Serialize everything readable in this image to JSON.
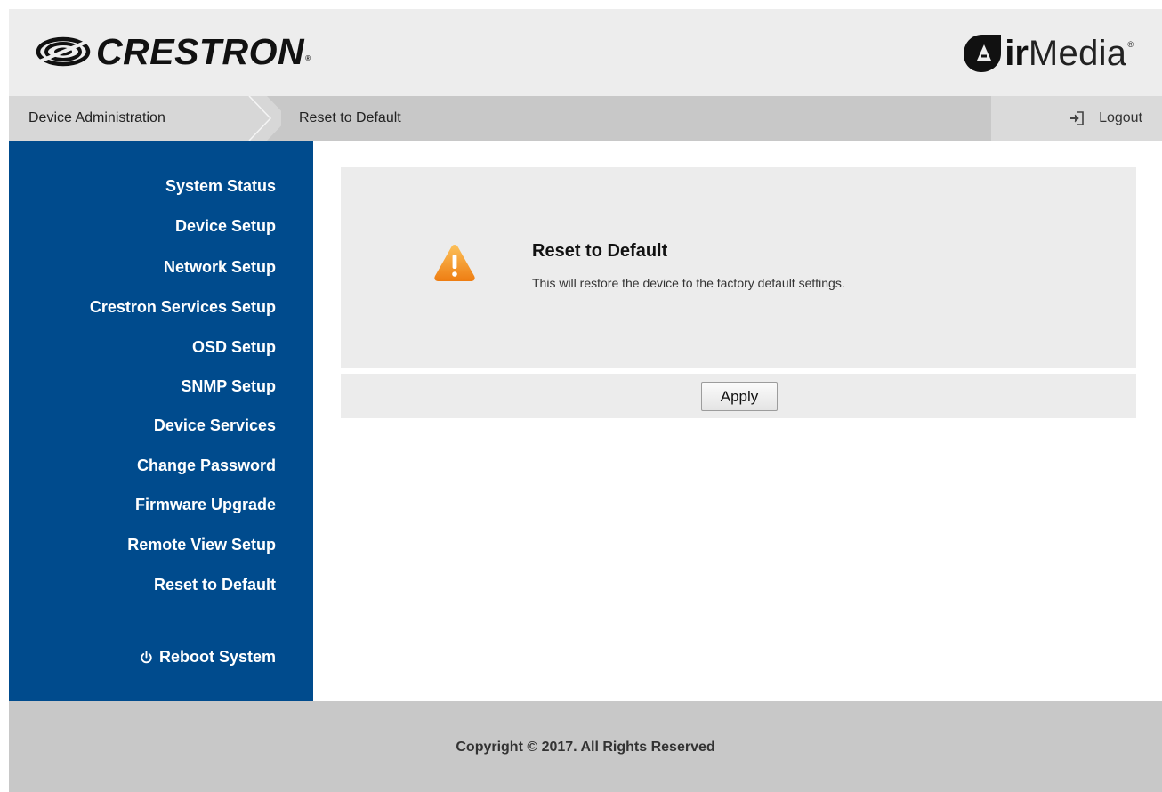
{
  "header": {
    "brand_logo": "CRESTRON",
    "brand_logo_mark": "®",
    "product_logo_bold": "ir",
    "product_logo_light": "Media",
    "product_logo_mark": "®"
  },
  "breadcrumb": {
    "root": "Device Administration",
    "current": "Reset to Default"
  },
  "logout": {
    "label": "Logout",
    "icon": "sign-in-arrow-icon"
  },
  "sidebar": {
    "items": [
      {
        "label": "System Status"
      },
      {
        "label": "Device Setup"
      },
      {
        "label": "Network Setup"
      },
      {
        "label": "Crestron Services Setup"
      },
      {
        "label": "OSD Setup"
      },
      {
        "label": "SNMP Setup"
      },
      {
        "label": "Device Services"
      },
      {
        "label": "Change Password"
      },
      {
        "label": "Firmware Upgrade"
      },
      {
        "label": "Remote View Setup"
      },
      {
        "label": "Reset to Default"
      }
    ],
    "reboot": {
      "label": "Reboot System",
      "icon": "power-icon"
    }
  },
  "panel": {
    "icon": "warning-icon",
    "title": "Reset to Default",
    "description": "This will restore the device to the factory default settings.",
    "apply_label": "Apply"
  },
  "footer": {
    "copyright": "Copyright © 2017. All Rights Reserved"
  },
  "colors": {
    "sidebar_bg": "#004b8d",
    "header_bg": "#ededed",
    "breadcrumb_bg": "#c8c8c8",
    "panel_bg": "#ececec",
    "warning_orange": "#f39c12"
  }
}
